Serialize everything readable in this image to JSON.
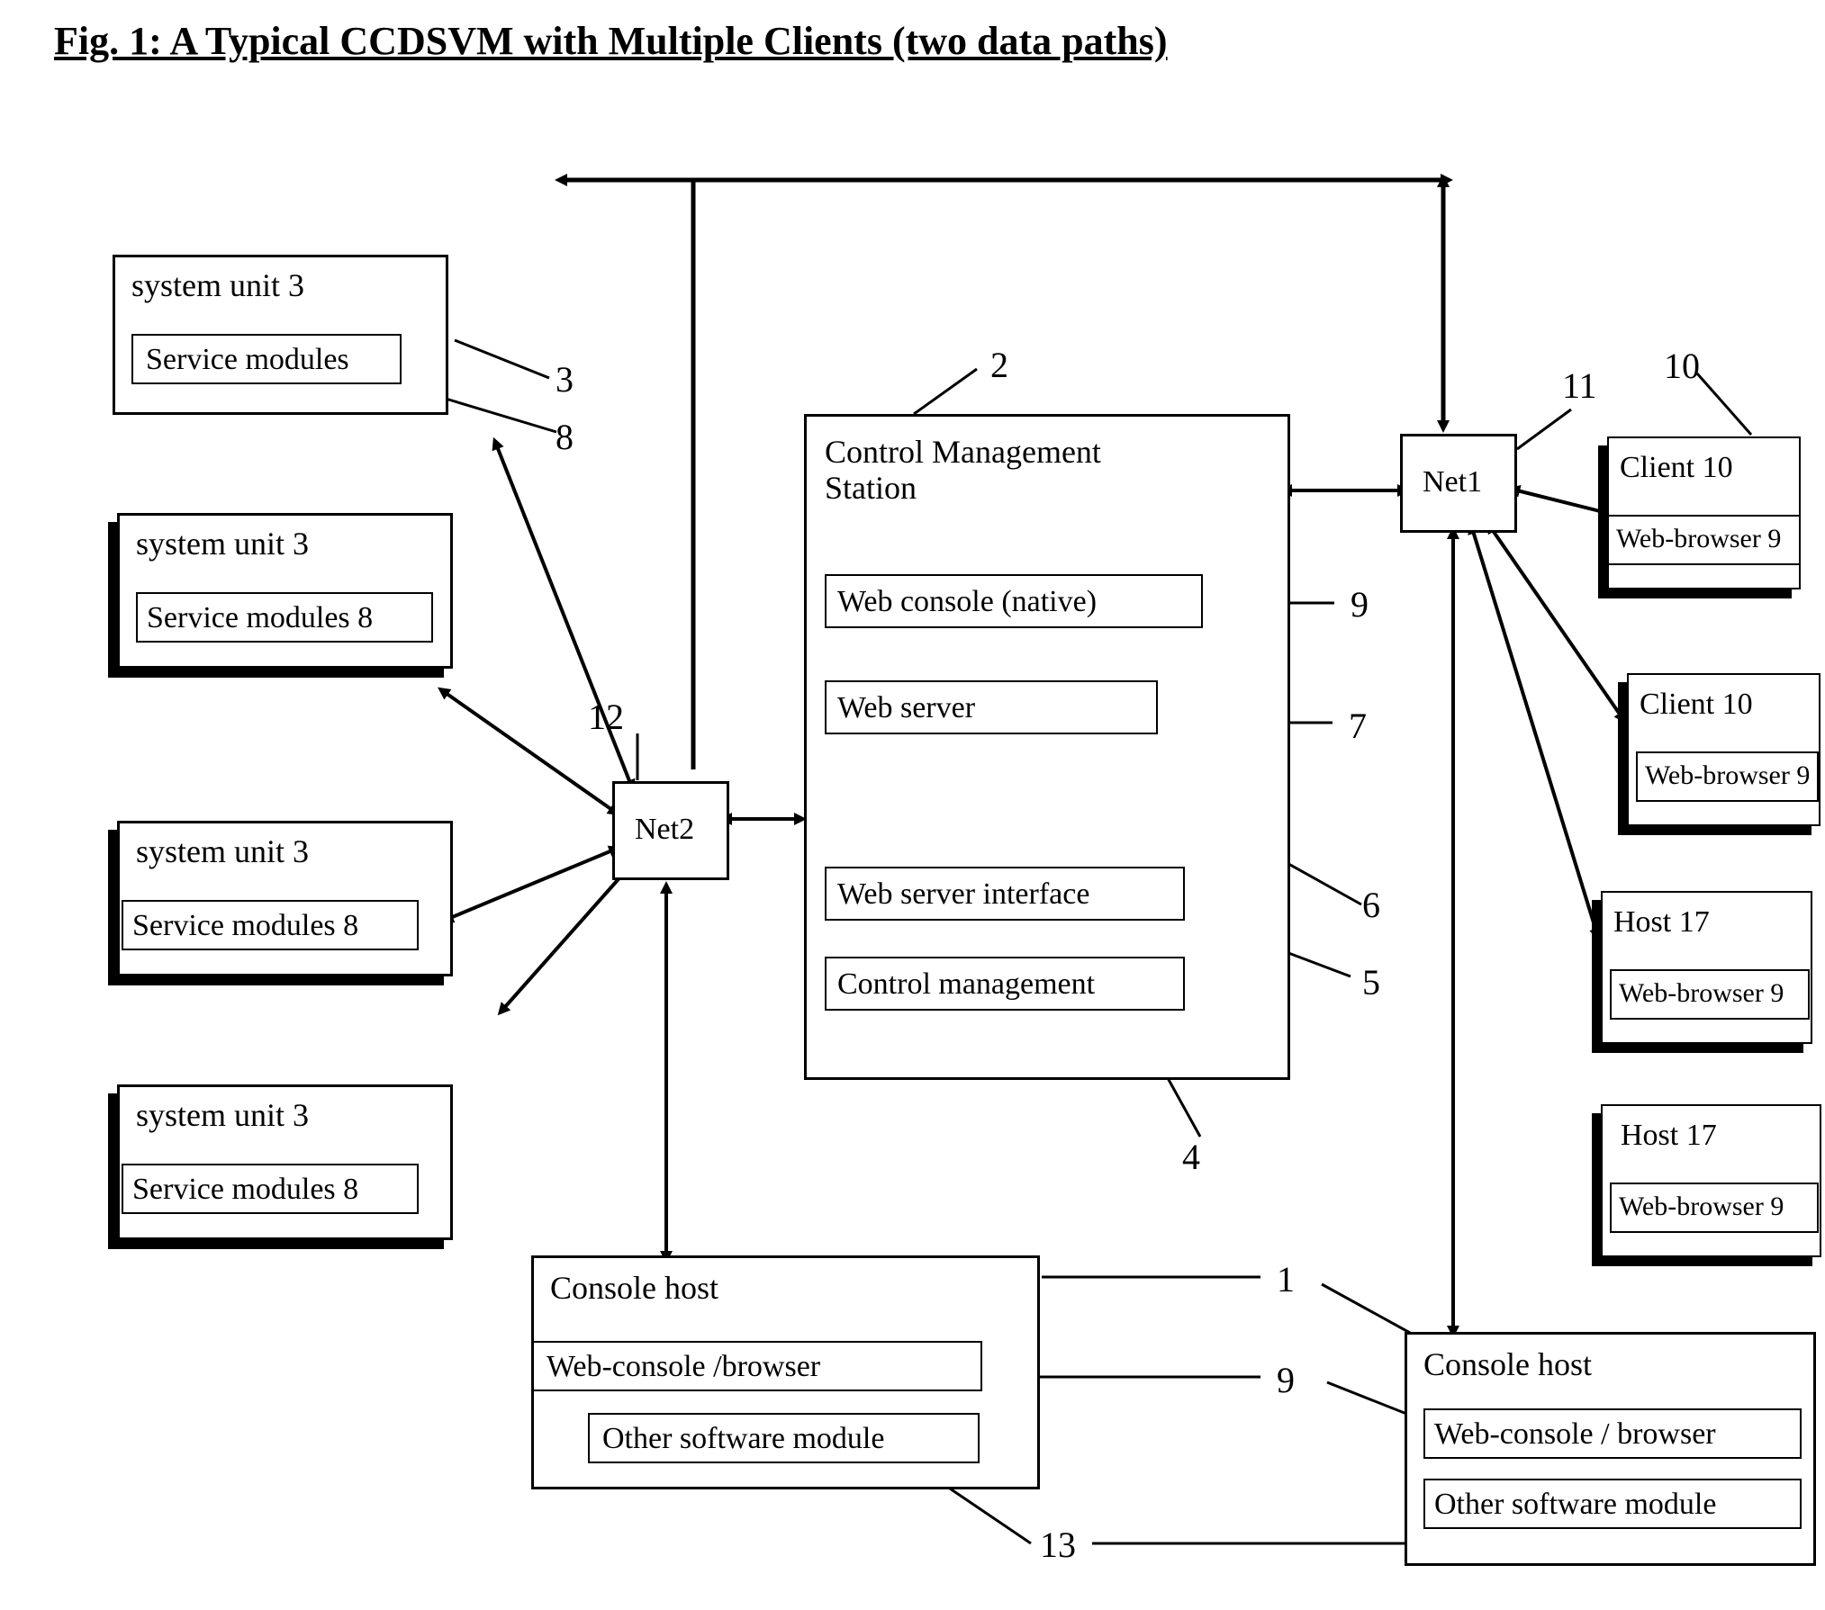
{
  "title": "Fig. 1: A Typical CCDSVM with Multiple Clients  (two data paths)",
  "labels": {
    "system_unit": "system unit 3",
    "system_unit_s": "system unit  3",
    "service_modules": "Service modules",
    "service_modules8": "Service modules 8",
    "cms": "Control Management Station",
    "web_console_native": "Web console (native)",
    "web_server": "Web server",
    "web_server_interface": "Web server interface",
    "control_management": "Control management",
    "net1": "Net1",
    "net2": "Net2",
    "client10": "Client 10",
    "web_browser9": "Web-browser 9",
    "host17": "Host 17",
    "console_host": "Console host",
    "web_console_browser": "Web-console /browser",
    "web_console_browser2": "Web-console / browser",
    "other_sw": "Other software module"
  },
  "numbers": {
    "n1": "1",
    "n2": "2",
    "n3": "3",
    "n4": "4",
    "n5": "5",
    "n6": "6",
    "n7": "7",
    "n8": "8",
    "n9": "9",
    "n10": "10",
    "n11": "11",
    "n12": "12",
    "n13": "13"
  }
}
